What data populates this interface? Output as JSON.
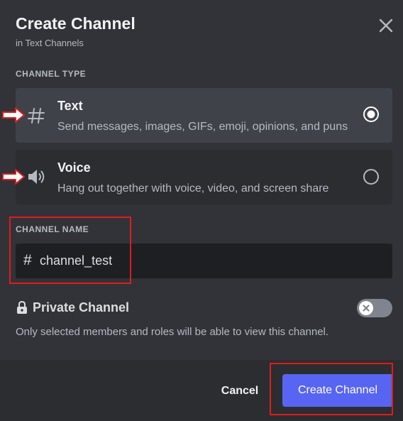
{
  "dialog": {
    "title": "Create Channel",
    "subtitle": "in Text Channels",
    "close_icon": "close-icon"
  },
  "channel_type": {
    "label": "CHANNEL TYPE",
    "options": [
      {
        "name": "Text",
        "description": "Send messages, images, GIFs, emoji, opinions, and puns",
        "icon": "hash-icon",
        "selected": true
      },
      {
        "name": "Voice",
        "description": "Hang out together with voice, video, and screen share",
        "icon": "speaker-icon",
        "selected": false
      }
    ]
  },
  "channel_name": {
    "label": "CHANNEL NAME",
    "prefix": "#",
    "value": "channel_test"
  },
  "private": {
    "label": "Private Channel",
    "description": "Only selected members and roles will be able to view this channel.",
    "enabled": false,
    "icon": "lock-icon"
  },
  "footer": {
    "cancel_label": "Cancel",
    "create_label": "Create Channel"
  },
  "colors": {
    "background": "#313338",
    "selected_card": "#404249",
    "input_bg": "#1e1f22",
    "footer_bg": "#2b2d31",
    "brand": "#5865f2",
    "annotation": "#e21b1b"
  }
}
